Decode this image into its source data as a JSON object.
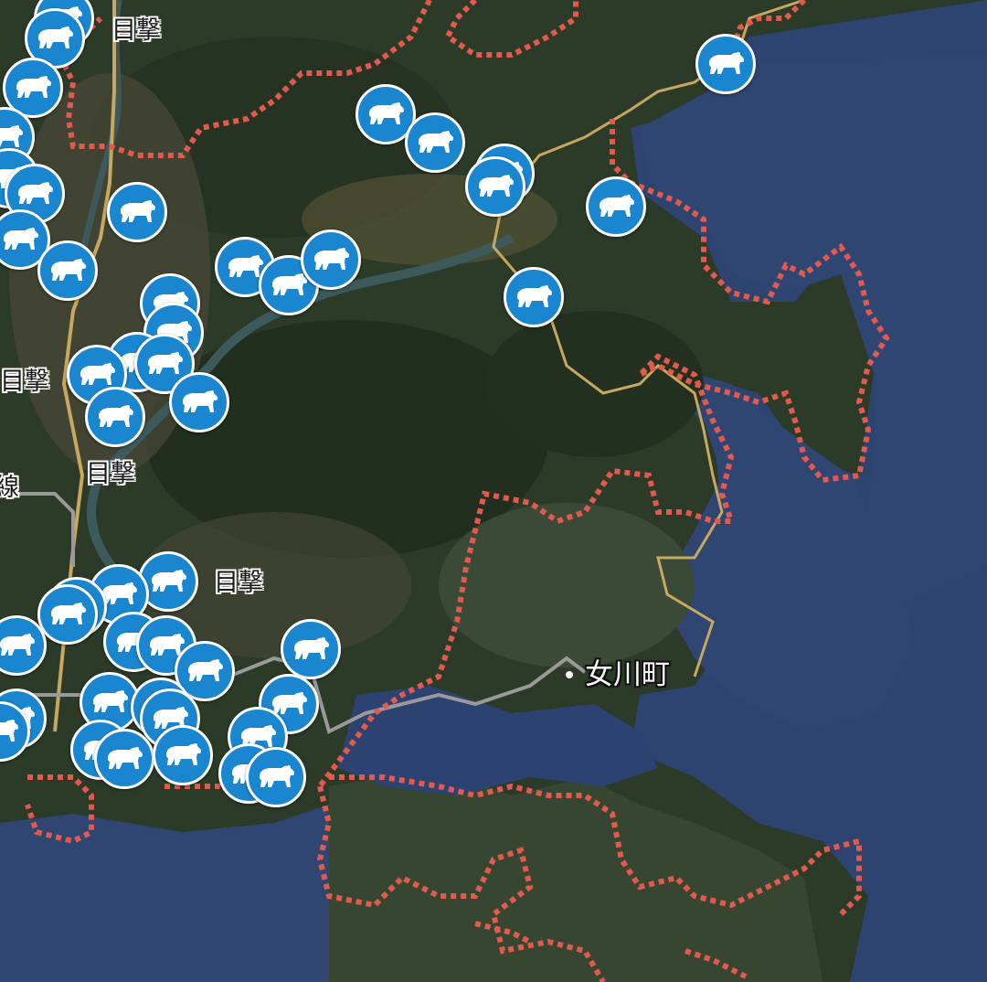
{
  "map": {
    "town_label": "女川町",
    "sighting_label": "目撃",
    "rail_label": "線",
    "marker_icon": "bear-icon",
    "marker_color": "#1a86d0",
    "boundary_color": "#e0443a"
  }
}
